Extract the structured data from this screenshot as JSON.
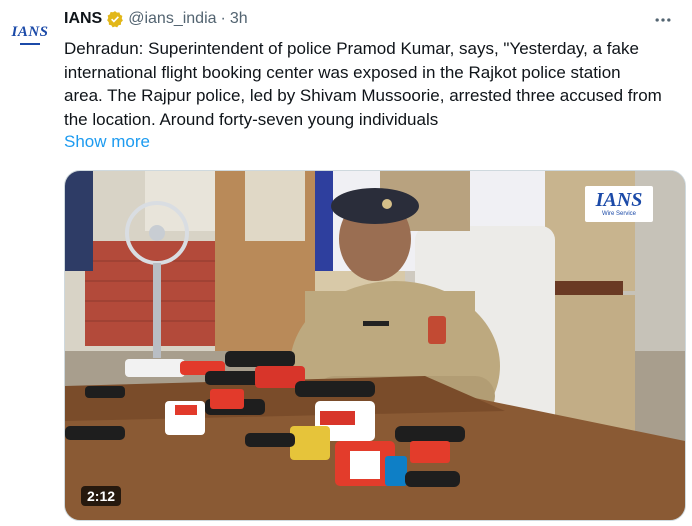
{
  "author": {
    "avatar_text": "IANS",
    "name": "IANS",
    "handle": "@ians_india",
    "separator": "·",
    "time": "3h"
  },
  "tweet": {
    "text": "Dehradun: Superintendent of police Pramod Kumar, says, \"Yesterday, a fake international flight booking center was exposed in the Rajkot police station area. The Rajpur police, led by Shivam Mussoorie, arrested three accused from the location. Around forty-seven young individuals",
    "show_more": "Show more"
  },
  "media": {
    "watermark_main": "IANS",
    "watermark_sub": "Wire Service",
    "duration": "2:12"
  },
  "colors": {
    "link": "#1d9bf0",
    "verified": "#e2b719",
    "muted": "#536471"
  },
  "icons": {
    "verified": "gold-verified-badge-icon",
    "more": "more-horizontal-icon"
  }
}
